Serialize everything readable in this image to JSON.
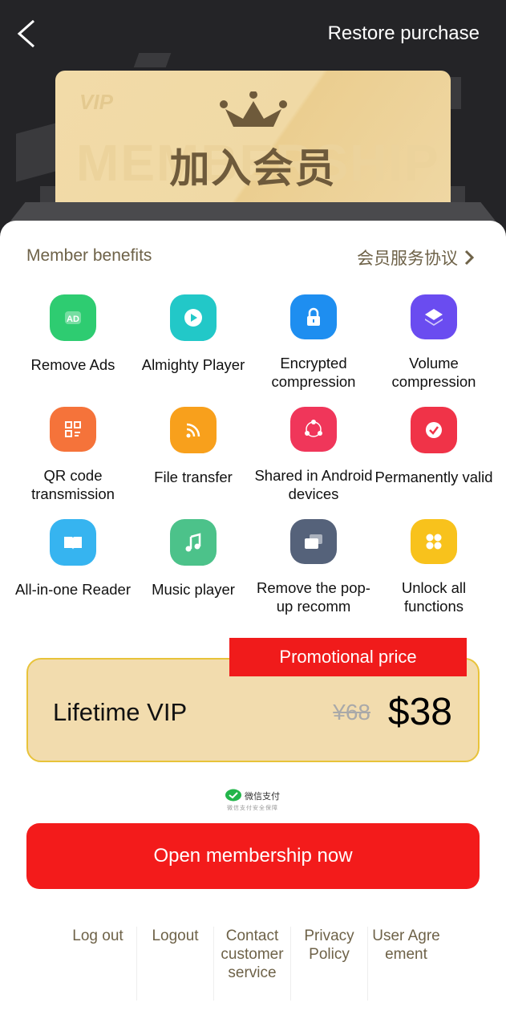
{
  "header": {
    "restore_label": "Restore purchase",
    "card_title": "加入会员",
    "card_watermark_vip": "VIP",
    "card_watermark": "MEMBERSHIP"
  },
  "benefits": {
    "title": "Member benefits",
    "agreement_link": "会员服务协议",
    "items": [
      {
        "label": "Remove Ads",
        "icon": "ad-icon",
        "color": "#2ecc71"
      },
      {
        "label": "Almighty Player",
        "icon": "play-icon",
        "color": "#22c8c8"
      },
      {
        "label": "Encrypted compression",
        "icon": "lock-icon",
        "color": "#1e8ef0"
      },
      {
        "label": "Volume compression",
        "icon": "layers-icon",
        "color": "#6a4cf0"
      },
      {
        "label": "QR code transmission",
        "icon": "qr-code-icon",
        "color": "#f5733a"
      },
      {
        "label": "File transfer",
        "icon": "rss-icon",
        "color": "#f8a01c"
      },
      {
        "label": "Shared in Android devices",
        "icon": "share-icon",
        "color": "#f0365a"
      },
      {
        "label": "Permanently valid",
        "icon": "check-icon",
        "color": "#f03348"
      },
      {
        "label": "All-in-one Reader",
        "icon": "book-icon",
        "color": "#36b4f0"
      },
      {
        "label": "Music player",
        "icon": "music-note-icon",
        "color": "#4cc28a"
      },
      {
        "label": "Remove the pop-up recomm",
        "icon": "windows-icon",
        "color": "#55627a"
      },
      {
        "label": "Unlock all functions",
        "icon": "grid-icon",
        "color": "#f8c21c"
      }
    ]
  },
  "plan": {
    "promo_label": "Promotional price",
    "name": "Lifetime VIP",
    "original_price": "¥68",
    "price": "$38"
  },
  "payment": {
    "name": "微信支付",
    "subtitle": "微信支付安全保障"
  },
  "cta_label": "Open membership now",
  "footer": [
    "Log out",
    "Logout",
    "Contact customer service",
    "Privacy Policy",
    "User Agre ement"
  ],
  "colors": {
    "accent": "#f31b1b",
    "gold": "#f2dcae",
    "border": "#e8c33a",
    "text_brown": "#6e6248"
  }
}
